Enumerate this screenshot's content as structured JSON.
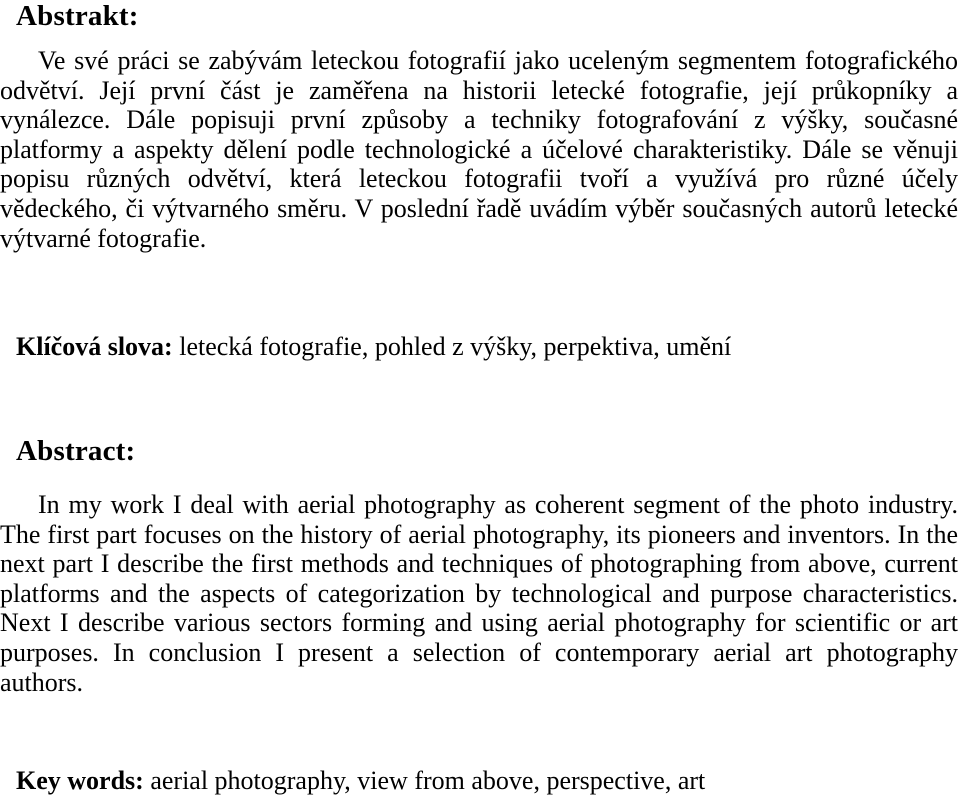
{
  "document": {
    "language_sections": [
      "czech",
      "english"
    ],
    "background_color": "#ffffff",
    "text_color": "#000000"
  },
  "czech": {
    "heading": "Abstrakt:",
    "abstract": "Ve své práci se zabývám leteckou fotografií jako uceleným segmentem fotografického odvětví. Její první část je zaměřena na historii letecké fotografie, její průkopníky a vynálezce. Dále popisuji první způsoby a techniky fotografování z výšky, současné platformy a aspekty dělení podle technologické a účelové charakteristiky. Dále se věnuji popisu různých odvětví, která leteckou fotografii tvoří a využívá pro různé účely vědeckého, či výtvarného směru. V poslední řadě uvádím výběr současných autorů letecké výtvarné fotografie.",
    "keywords_label": "Klíčová slova:",
    "keywords_value": "letecká fotografie, pohled z výšky, perpektiva, umění"
  },
  "english": {
    "heading": "Abstract:",
    "abstract": "In my work I deal with aerial photography as coherent segment of the photo industry. The first part focuses on the history of aerial photography, its pioneers and inventors. In the next part I describe the first methods and techniques of photographing from above, current platforms and the aspects of categorization by technological and purpose characteristics. Next I describe various sectors forming and using aerial photography for scientific or art purposes. In conclusion I present a selection of contemporary aerial art photography authors.",
    "keywords_label": "Key words:",
    "keywords_value": "aerial photography, view from above, perspective, art"
  }
}
